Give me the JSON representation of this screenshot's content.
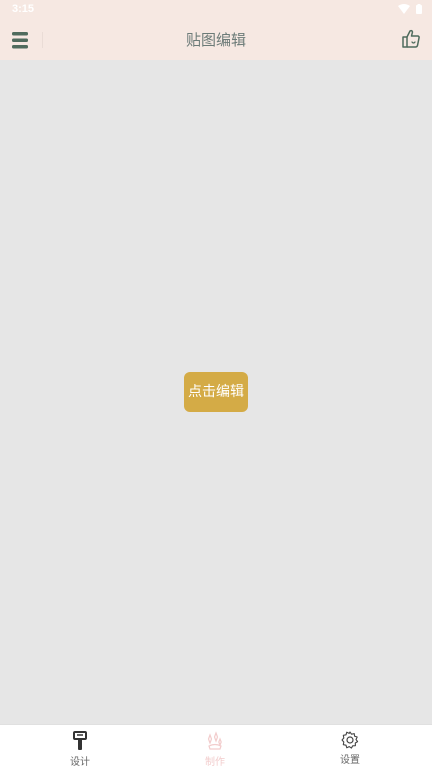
{
  "status_bar": {
    "time": "3:15"
  },
  "toolbar": {
    "title": "贴图编辑"
  },
  "main": {
    "edit_button_label": "点击编辑"
  },
  "bottom_nav": {
    "items": [
      {
        "label": "设计",
        "icon": "paint-brush-icon",
        "active": true
      },
      {
        "label": "制作",
        "icon": "magic-icon",
        "active": false
      },
      {
        "label": "设置",
        "icon": "gear-icon",
        "active": false
      }
    ]
  },
  "colors": {
    "toolbar_bg": "#f6e8e2",
    "accent": "#d4ab46",
    "title_text": "#6c7b78",
    "icon_dark": "#4f6b5d",
    "inactive_pink": "#f2cccc"
  }
}
